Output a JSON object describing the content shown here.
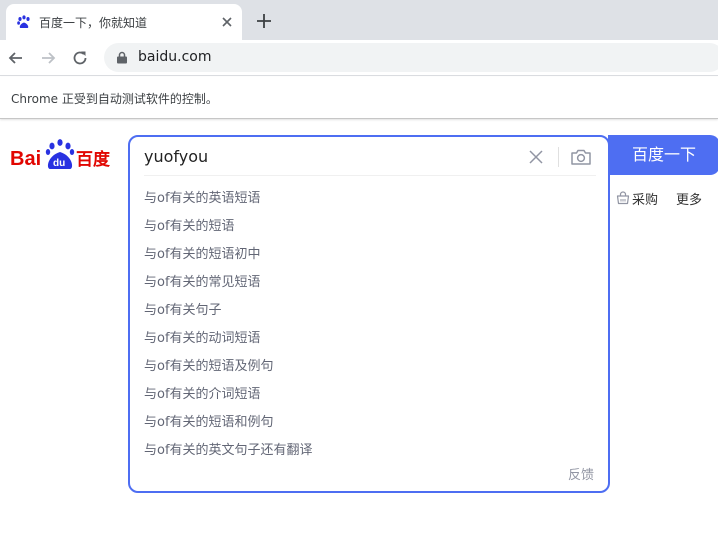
{
  "browser": {
    "tab_title": "百度一下，你就知道",
    "url": "baidu.com",
    "infobar": "Chrome 正受到自动测试软件的控制。"
  },
  "logo": {
    "text_left": "Bai",
    "text_paw": "du",
    "text_right": "百度"
  },
  "search": {
    "query": "yuofyou",
    "button_label": "百度一下",
    "suggestions": [
      "与of有关的英语短语",
      "与of有关的短语",
      "与of有关的短语初中",
      "与of有关的常见短语",
      "与of有关句子",
      "与of有关的动词短语",
      "与of有关的短语及例句",
      "与of有关的介词短语",
      "与of有关的短语和例句",
      "与of有关的英文句子还有翻译"
    ],
    "feedback": "反馈"
  },
  "nav": {
    "purchase": "采购",
    "more": "更多"
  },
  "colors": {
    "accent": "#4e6ef2",
    "logo_red": "#e10601",
    "logo_blue": "#2932e1"
  }
}
